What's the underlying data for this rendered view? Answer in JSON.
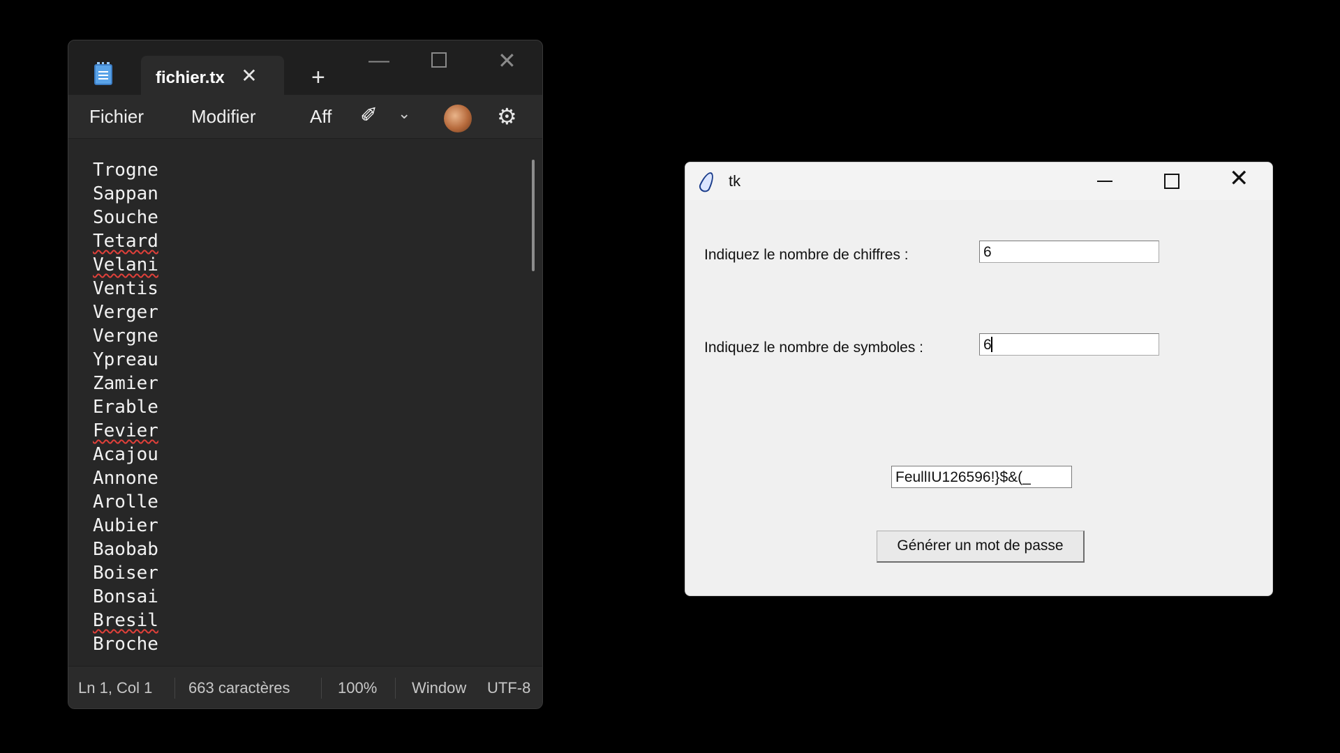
{
  "notepad": {
    "tab_title": "fichier.tx",
    "menu": [
      "Fichier",
      "Modifier",
      "Aff"
    ],
    "lines": [
      {
        "text": "Trogne",
        "misspelled": false
      },
      {
        "text": "Sappan",
        "misspelled": false
      },
      {
        "text": "Souche",
        "misspelled": false
      },
      {
        "text": "Tetard",
        "misspelled": true
      },
      {
        "text": "Velani",
        "misspelled": true
      },
      {
        "text": "Ventis",
        "misspelled": false
      },
      {
        "text": "Verger",
        "misspelled": false
      },
      {
        "text": "Vergne",
        "misspelled": false
      },
      {
        "text": "Ypreau",
        "misspelled": false
      },
      {
        "text": "Zamier",
        "misspelled": false
      },
      {
        "text": "Erable",
        "misspelled": false
      },
      {
        "text": "Fevier",
        "misspelled": true
      },
      {
        "text": "Acajou",
        "misspelled": false
      },
      {
        "text": "Annone",
        "misspelled": false
      },
      {
        "text": "Arolle",
        "misspelled": false
      },
      {
        "text": "Aubier",
        "misspelled": false
      },
      {
        "text": "Baobab",
        "misspelled": false
      },
      {
        "text": "Boiser",
        "misspelled": false
      },
      {
        "text": "Bonsai",
        "misspelled": false
      },
      {
        "text": "Bresil",
        "misspelled": true
      },
      {
        "text": "Broche",
        "misspelled": false
      }
    ],
    "status": {
      "position": "Ln 1, Col 1",
      "chars": "663 caractères",
      "zoom": "100%",
      "line_ending": "Window",
      "encoding": "UTF-8"
    },
    "icons": {
      "app": "notepad-icon",
      "tab_close": "close-icon",
      "new_tab": "plus-icon",
      "copilot": "sparkle-pen-icon",
      "dropdown": "chevron-down-icon",
      "account": "avatar-icon",
      "settings": "gear-icon"
    }
  },
  "tk": {
    "title": "tk",
    "label_digits": "Indiquez le nombre de chiffres :",
    "value_digits": "6",
    "label_symbols": "Indiquez le nombre de symboles :",
    "value_symbols": "6",
    "result": "FeullIU126596!}$&(_",
    "generate_button": "Générer un mot de passe"
  }
}
